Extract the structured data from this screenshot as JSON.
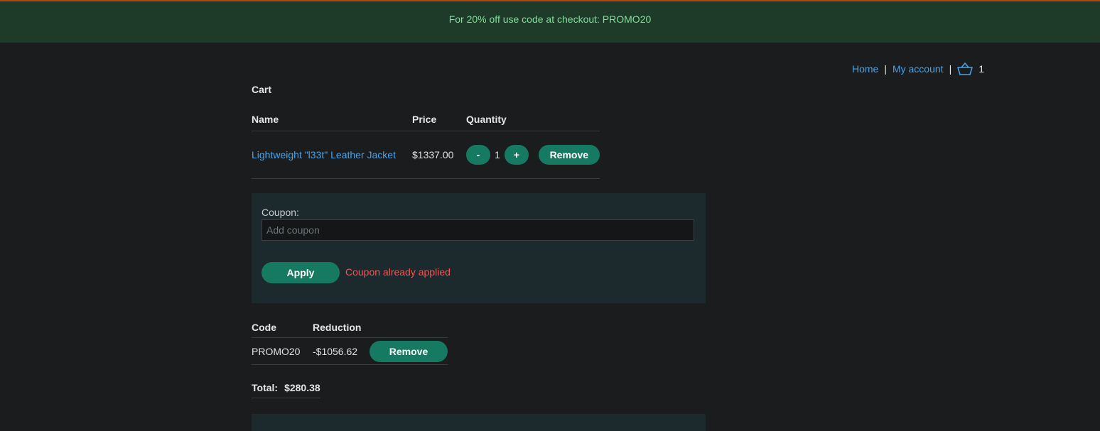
{
  "banner": {
    "text": "For 20% off use code at checkout: PROMO20"
  },
  "nav": {
    "home": "Home",
    "separator": "|",
    "my_account": "My account",
    "cart_icon": "basket-icon",
    "cart_count": "1"
  },
  "cart": {
    "title": "Cart",
    "columns": {
      "name": "Name",
      "price": "Price",
      "quantity": "Quantity"
    },
    "items": [
      {
        "name": "Lightweight \"l33t\" Leather Jacket",
        "price": "$1337.00",
        "decrement_label": "-",
        "quantity": "1",
        "increment_label": "+",
        "remove_label": "Remove"
      }
    ]
  },
  "coupon": {
    "label": "Coupon:",
    "placeholder": "Add coupon",
    "value": "",
    "apply_label": "Apply",
    "error": "Coupon already applied"
  },
  "discounts": {
    "columns": {
      "code": "Code",
      "reduction": "Reduction"
    },
    "items": [
      {
        "code": "PROMO20",
        "reduction": "-$1056.62",
        "remove_label": "Remove"
      }
    ]
  },
  "total": {
    "label": "Total:",
    "value": "$280.38"
  },
  "colors": {
    "banner_bg": "#1d3b28",
    "banner_text": "#7fe09a",
    "accent_button": "#167a62",
    "link": "#4aa3e6",
    "error": "#ff4f4f",
    "page_bg": "#1b1c1e"
  }
}
